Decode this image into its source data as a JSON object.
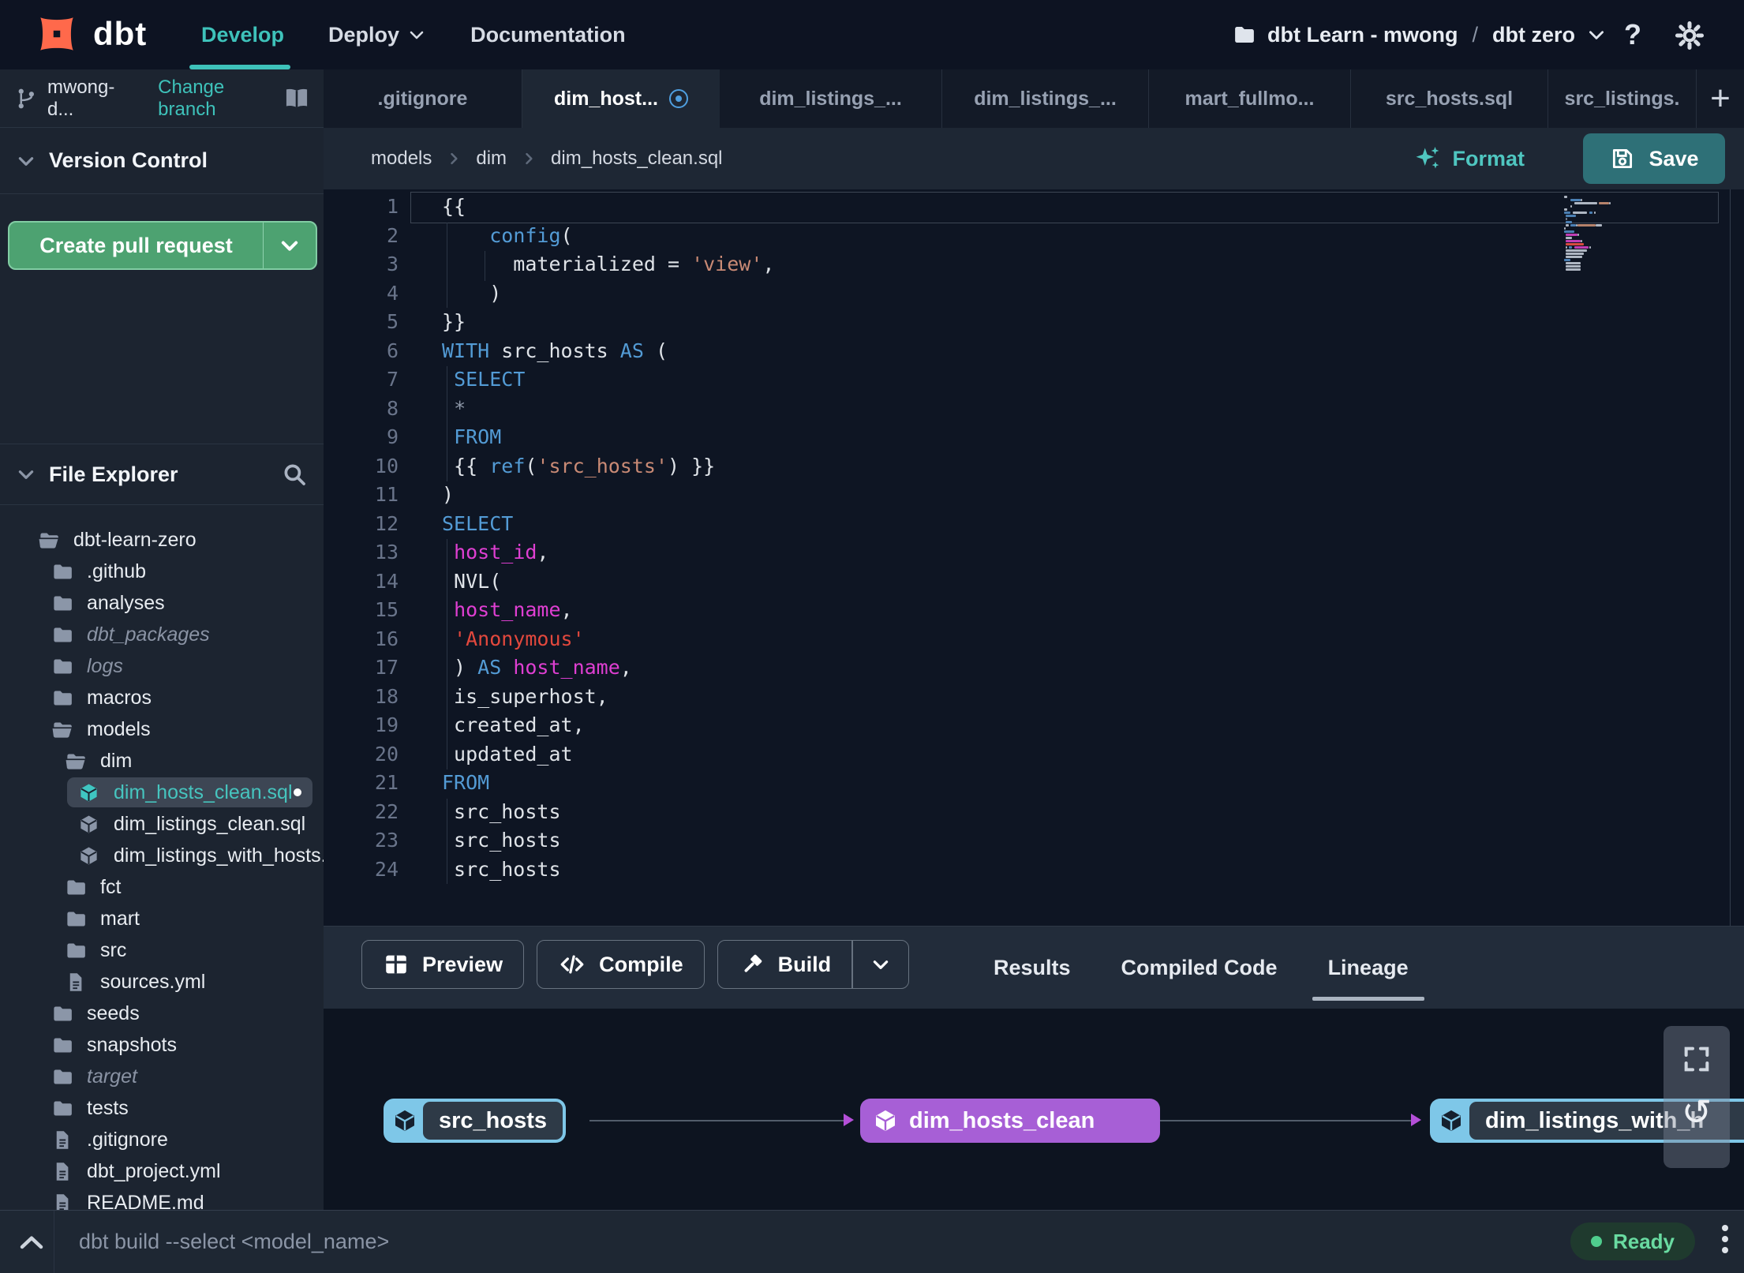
{
  "header": {
    "brand": "dbt",
    "nav": [
      {
        "label": "Develop",
        "active": true,
        "caret": false
      },
      {
        "label": "Deploy",
        "active": false,
        "caret": true
      },
      {
        "label": "Documentation",
        "active": false,
        "caret": false
      }
    ],
    "project_switcher": {
      "account": "dbt Learn - mwong",
      "separator": "/",
      "project": "dbt zero"
    },
    "help_label": "?"
  },
  "sidebar": {
    "branch": {
      "name": "mwong-d...",
      "change_link": "Change branch"
    },
    "version_control": {
      "title": "Version Control",
      "create_pr_label": "Create pull request"
    },
    "file_explorer": {
      "title": "File Explorer"
    },
    "tree": [
      {
        "label": "dbt-learn-zero",
        "icon": "folder-open",
        "level": 0
      },
      {
        "label": ".github",
        "icon": "folder",
        "level": 1
      },
      {
        "label": "analyses",
        "icon": "folder",
        "level": 1
      },
      {
        "label": "dbt_packages",
        "icon": "folder",
        "level": 1,
        "dim": true
      },
      {
        "label": "logs",
        "icon": "folder",
        "level": 1,
        "dim": true
      },
      {
        "label": "macros",
        "icon": "folder",
        "level": 1
      },
      {
        "label": "models",
        "icon": "folder-open",
        "level": 1
      },
      {
        "label": "dim",
        "icon": "folder-open",
        "level": 2
      },
      {
        "label": "dim_hosts_clean.sql",
        "icon": "model",
        "level": 3,
        "selected": true,
        "modified": true
      },
      {
        "label": "dim_listings_clean.sql",
        "icon": "model",
        "level": 3
      },
      {
        "label": "dim_listings_with_hosts...",
        "icon": "model",
        "level": 3
      },
      {
        "label": "fct",
        "icon": "folder",
        "level": 2
      },
      {
        "label": "mart",
        "icon": "folder",
        "level": 2
      },
      {
        "label": "src",
        "icon": "folder",
        "level": 2
      },
      {
        "label": "sources.yml",
        "icon": "file",
        "level": 2
      },
      {
        "label": "seeds",
        "icon": "folder",
        "level": 1
      },
      {
        "label": "snapshots",
        "icon": "folder",
        "level": 1
      },
      {
        "label": "target",
        "icon": "folder",
        "level": 1,
        "dim": true
      },
      {
        "label": "tests",
        "icon": "folder",
        "level": 1
      },
      {
        "label": ".gitignore",
        "icon": "file",
        "level": 1
      },
      {
        "label": "dbt_project.yml",
        "icon": "file",
        "level": 1
      },
      {
        "label": "README.md",
        "icon": "file",
        "level": 1
      }
    ]
  },
  "tabs": {
    "items": [
      {
        "label": ".gitignore"
      },
      {
        "label": "dim_host...",
        "active": true,
        "modified": true
      },
      {
        "label": "dim_listings_..."
      },
      {
        "label": "dim_listings_..."
      },
      {
        "label": "mart_fullmo..."
      },
      {
        "label": "src_hosts.sql"
      },
      {
        "label": "src_listings."
      }
    ],
    "new_tab_label": "+"
  },
  "toolbar": {
    "breadcrumb": [
      "models",
      "dim",
      "dim_hosts_clean.sql"
    ],
    "format_label": "Format",
    "save_label": "Save"
  },
  "editor": {
    "lines": [
      [
        [
          "p",
          "{{"
        ]
      ],
      [
        [
          "p",
          "    "
        ],
        [
          "k",
          "config"
        ],
        [
          "p",
          "("
        ]
      ],
      [
        [
          "p",
          "      materialized = "
        ],
        [
          "s",
          "'view'"
        ],
        [
          "p",
          ","
        ]
      ],
      [
        [
          "p",
          "    )"
        ]
      ],
      [
        [
          "p",
          "}}"
        ]
      ],
      [
        [
          "k",
          "WITH"
        ],
        [
          "p",
          " src_hosts "
        ],
        [
          "k",
          "AS"
        ],
        [
          "p",
          " ("
        ]
      ],
      [
        [
          "p",
          " "
        ],
        [
          "k",
          "SELECT"
        ]
      ],
      [
        [
          "p",
          " "
        ],
        [
          "d",
          "*"
        ]
      ],
      [
        [
          "p",
          " "
        ],
        [
          "k",
          "FROM"
        ]
      ],
      [
        [
          "p",
          " {{ "
        ],
        [
          "k",
          "ref"
        ],
        [
          "p",
          "("
        ],
        [
          "s",
          "'src_hosts'"
        ],
        [
          "p",
          ") }}"
        ]
      ],
      [
        [
          "p",
          ")"
        ]
      ],
      [
        [
          "k",
          "SELECT"
        ]
      ],
      [
        [
          "p",
          " "
        ],
        [
          "m",
          "host_id"
        ],
        [
          "p",
          ","
        ]
      ],
      [
        [
          "p",
          " NVL("
        ]
      ],
      [
        [
          "p",
          " "
        ],
        [
          "m",
          "host_name"
        ],
        [
          "p",
          ","
        ]
      ],
      [
        [
          "p",
          " "
        ],
        [
          "e",
          "'Anonymous'"
        ]
      ],
      [
        [
          "p",
          " ) "
        ],
        [
          "k",
          "AS"
        ],
        [
          "p",
          " "
        ],
        [
          "m",
          "host_name"
        ],
        [
          "p",
          ","
        ]
      ],
      [
        [
          "p",
          " is_superhost,"
        ]
      ],
      [
        [
          "p",
          " created_at,"
        ]
      ],
      [
        [
          "p",
          " updated_at"
        ]
      ],
      [
        [
          "k",
          "FROM"
        ]
      ],
      [
        [
          "p",
          " src_hosts"
        ]
      ],
      [
        [
          "p",
          " src_hosts"
        ]
      ],
      [
        [
          "p",
          " src_hosts"
        ]
      ]
    ]
  },
  "bottom_panel": {
    "buttons": [
      {
        "label": "Preview",
        "icon": "table"
      },
      {
        "label": "Compile",
        "icon": "code"
      },
      {
        "label": "Build",
        "icon": "hammer",
        "split": true
      }
    ],
    "tabs": [
      {
        "label": "Results"
      },
      {
        "label": "Compiled Code"
      },
      {
        "label": "Lineage",
        "active": true
      }
    ]
  },
  "lineage": {
    "nodes": [
      {
        "label": "src_hosts",
        "variant": "outlined-blue"
      },
      {
        "label": "dim_hosts_clean",
        "variant": "filled-purple"
      },
      {
        "label": "dim_listings_with_h",
        "variant": "outlined-blue"
      }
    ]
  },
  "status_bar": {
    "command": "dbt build --select <model_name>",
    "status_label": "Ready"
  },
  "colors": {
    "accent_teal": "#3ec2ba",
    "button_green": "#4da271",
    "save_teal": "#2e7077",
    "node_blue": "#7ec7e8",
    "node_purple": "#a75fd6",
    "syntax_keyword": "#539bd5",
    "syntax_string": "#c98a75",
    "syntax_error_string": "#e2483d",
    "syntax_identifier": "#df3fd2",
    "status_green": "#69dba1",
    "logo_orange": "#ff694b"
  }
}
